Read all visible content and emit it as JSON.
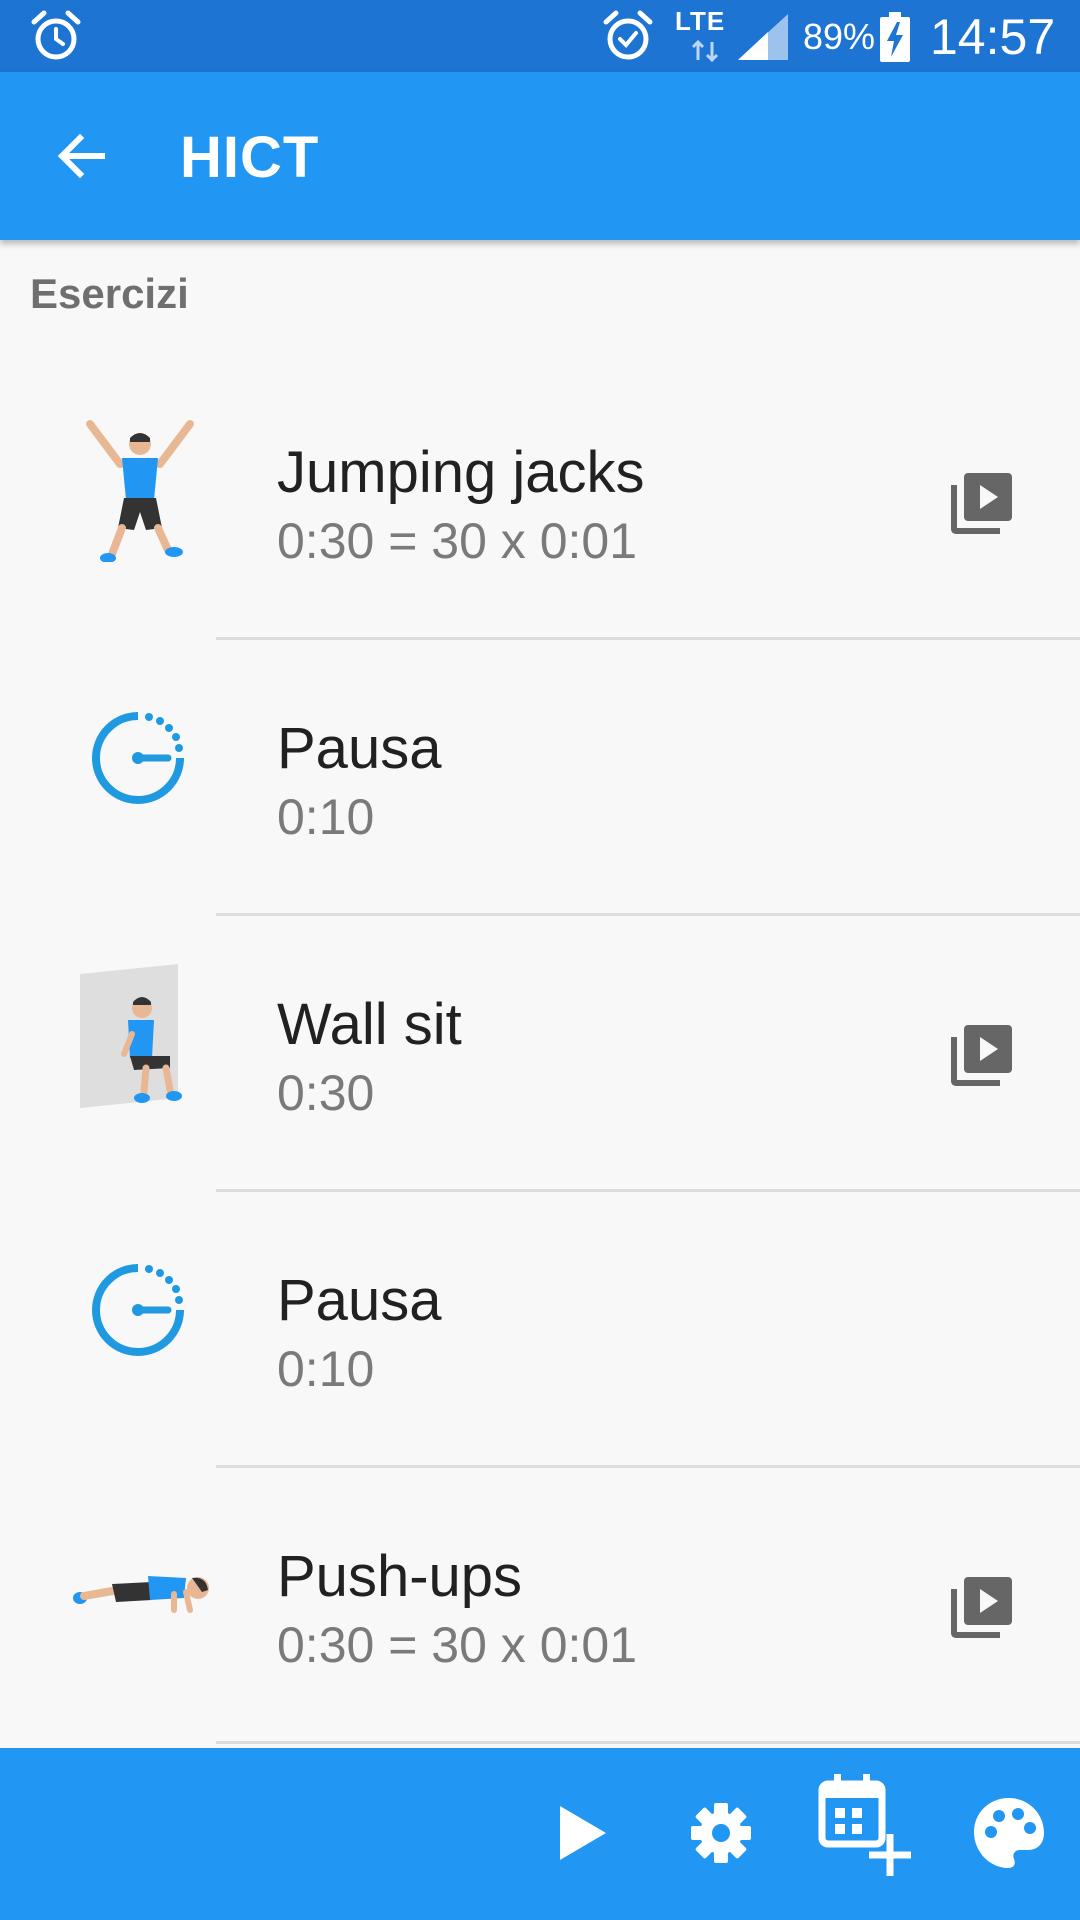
{
  "status_bar": {
    "network": "LTE",
    "battery": "89%",
    "time": "14:57",
    "icons": [
      "alarm-icon",
      "alarm-check-icon",
      "signal-icon",
      "battery-charging-icon"
    ]
  },
  "app_bar": {
    "title": "HICT",
    "back_icon": "arrow-back-icon"
  },
  "section": {
    "title": "Esercizi"
  },
  "exercises": [
    {
      "name": "Jumping jacks",
      "duration": "0:30 = 30 x 0:01",
      "icon": "jumping-jacks-figure",
      "has_video": true
    },
    {
      "name": "Pausa",
      "duration": "0:10",
      "icon": "timer-icon",
      "has_video": false
    },
    {
      "name": "Wall sit",
      "duration": "0:30",
      "icon": "wall-sit-figure",
      "has_video": true
    },
    {
      "name": "Pausa",
      "duration": "0:10",
      "icon": "timer-icon",
      "has_video": false
    },
    {
      "name": "Push-ups",
      "duration": "0:30 = 30 x 0:01",
      "icon": "push-ups-figure",
      "has_video": true
    }
  ],
  "bottom_bar": {
    "actions": [
      "play-icon",
      "settings-icon",
      "calendar-add-icon",
      "palette-icon"
    ]
  },
  "colors": {
    "status_bar": "#1e74d2",
    "primary": "#2196f3",
    "accent_icon": "#1f9ae0",
    "video_icon": "#666666"
  }
}
